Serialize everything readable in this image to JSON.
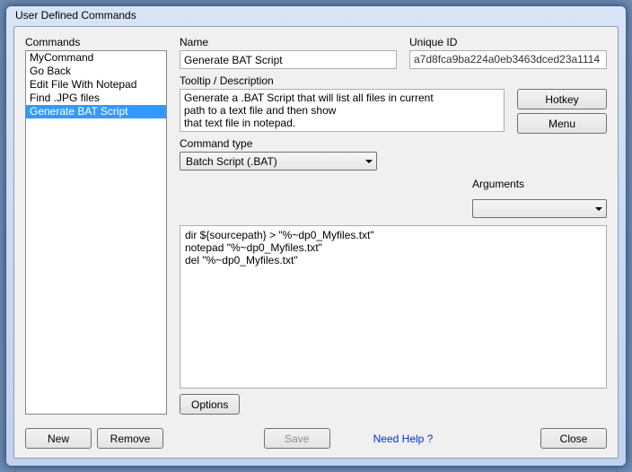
{
  "window": {
    "title": "User Defined Commands"
  },
  "left": {
    "label": "Commands",
    "items": [
      {
        "label": "MyCommand",
        "selected": false
      },
      {
        "label": "Go Back",
        "selected": false
      },
      {
        "label": "Edit File With Notepad",
        "selected": false
      },
      {
        "label": "Find .JPG files",
        "selected": false
      },
      {
        "label": "Generate BAT Script",
        "selected": true
      }
    ]
  },
  "fields": {
    "name_label": "Name",
    "name_value": "Generate BAT Script",
    "uid_label": "Unique ID",
    "uid_value": "a7d8fca9ba224a0eb3463dced23a1114",
    "tooltip_label": "Tooltip / Description",
    "tooltip_value": "Generate a .BAT Script that will list all files in current\npath to a text file and then show\nthat text file in notepad.",
    "cmdtype_label": "Command type",
    "cmdtype_value": "Batch Script (.BAT)",
    "arguments_label": "Arguments",
    "arguments_value": "",
    "script_value": "dir ${sourcepath} > \"%~dp0_Myfiles.txt\"\nnotepad \"%~dp0_Myfiles.txt\"\ndel \"%~dp0_Myfiles.txt\""
  },
  "buttons": {
    "hotkey": "Hotkey",
    "menu": "Menu",
    "options": "Options",
    "new": "New",
    "remove": "Remove",
    "save": "Save",
    "close": "Close",
    "help": "Need Help ?"
  }
}
